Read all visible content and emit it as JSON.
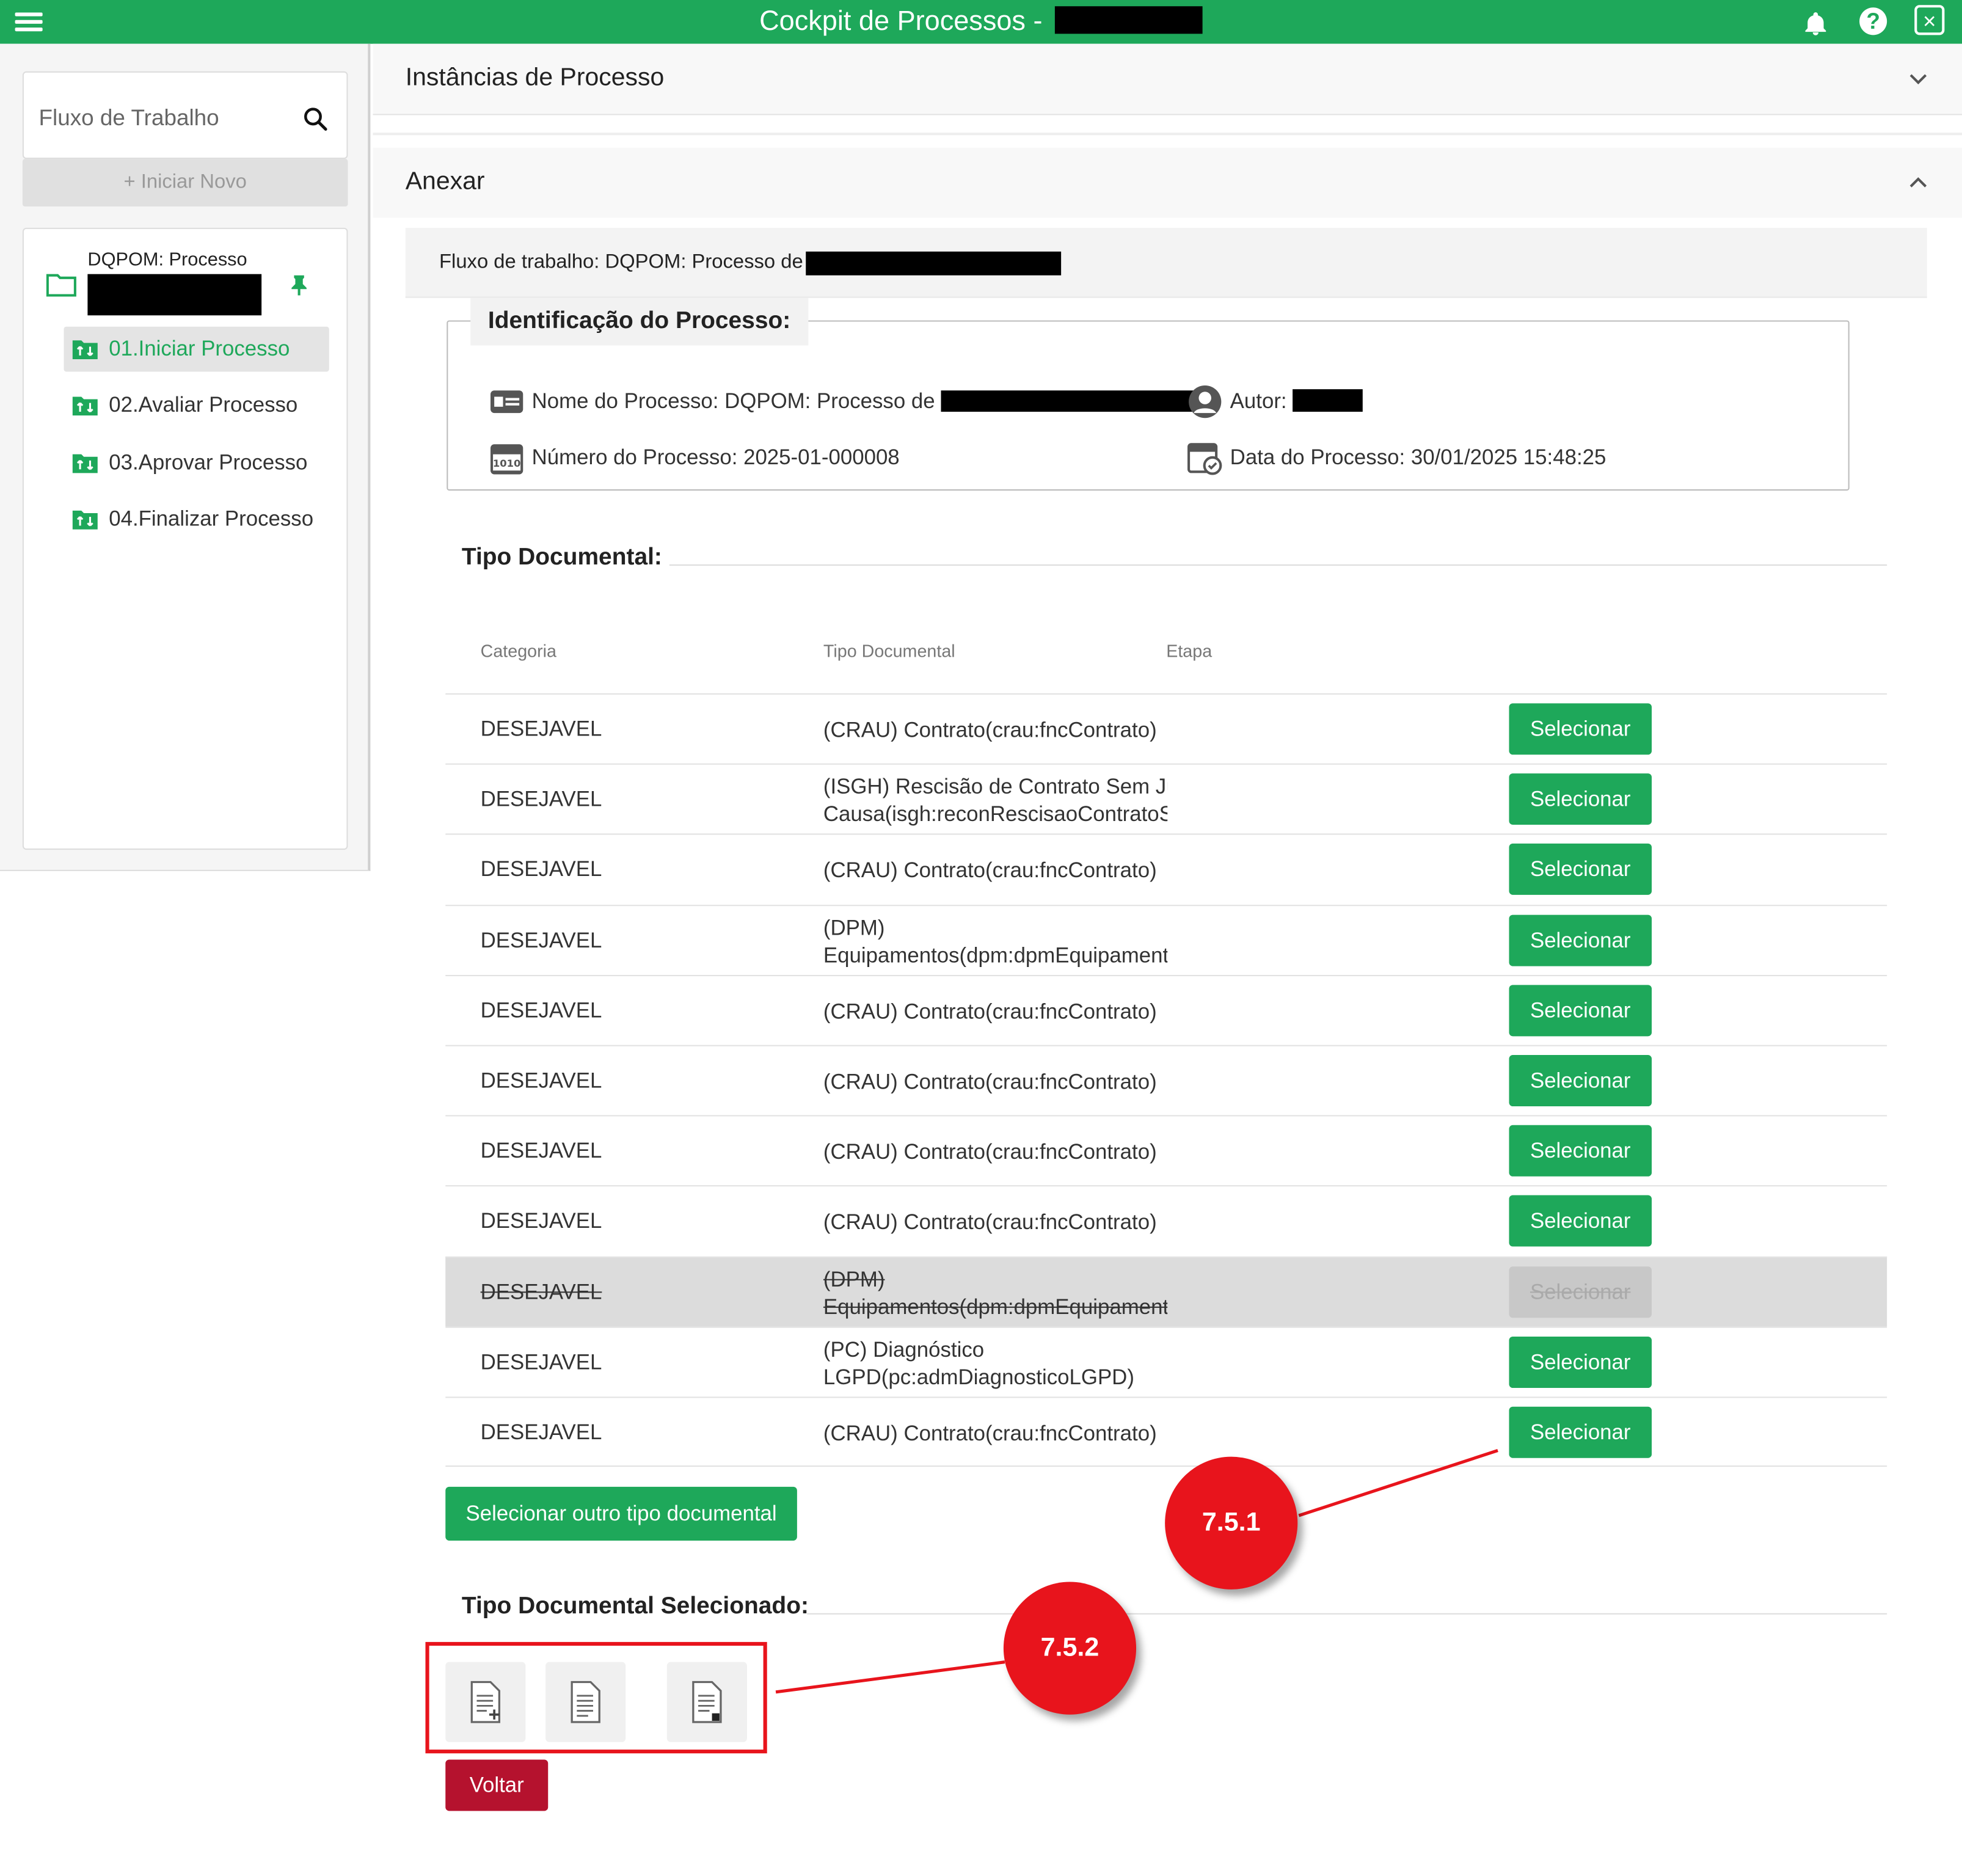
{
  "app": {
    "title": "Cockpit de Processos - ",
    "help_glyph": "?",
    "close_glyph": "×"
  },
  "sidebar": {
    "search_placeholder": "Fluxo de Trabalho",
    "new_button": "+ Iniciar Novo",
    "process_label": "DQPOM: Processo",
    "steps": [
      {
        "label": "01.Iniciar Processo",
        "active": true
      },
      {
        "label": "02.Avaliar Processo",
        "active": false
      },
      {
        "label": "03.Aprovar Processo",
        "active": false
      },
      {
        "label": "04.Finalizar Processo",
        "active": false
      }
    ]
  },
  "main": {
    "section_instances": "Instâncias de Processo",
    "section_anexar": "Anexar",
    "fluxo_label": "Fluxo de trabalho: DQPOM: Processo de ",
    "identification": {
      "legend": "Identificação do Processo:",
      "nome_label": "Nome do Processo: DQPOM: Processo de ",
      "autor_label": "Autor: ",
      "numero_label": "Número do Processo: 2025-01-000008",
      "data_label": "Data do Processo: 30/01/2025 15:48:25"
    },
    "tipo_documental_title": "Tipo Documental:",
    "table": {
      "headers": [
        "Categoria",
        "Tipo Documental",
        "Etapa"
      ],
      "rows": [
        {
          "categoria": "DESEJAVEL",
          "tipo": [
            "(CRAU) Contrato(crau:fncContrato)"
          ],
          "button": "Selecionar",
          "disabled": false
        },
        {
          "categoria": "DESEJAVEL",
          "tipo": [
            "(ISGH) Rescisão de Contrato Sem Jus",
            "Causa(isgh:reconRescisaoContratoSe"
          ],
          "button": "Selecionar",
          "disabled": false
        },
        {
          "categoria": "DESEJAVEL",
          "tipo": [
            "(CRAU) Contrato(crau:fncContrato)"
          ],
          "button": "Selecionar",
          "disabled": false
        },
        {
          "categoria": "DESEJAVEL",
          "tipo": [
            "(DPM)",
            "Equipamentos(dpm:dpmEquipament"
          ],
          "button": "Selecionar",
          "disabled": false
        },
        {
          "categoria": "DESEJAVEL",
          "tipo": [
            "(CRAU) Contrato(crau:fncContrato)"
          ],
          "button": "Selecionar",
          "disabled": false
        },
        {
          "categoria": "DESEJAVEL",
          "tipo": [
            "(CRAU) Contrato(crau:fncContrato)"
          ],
          "button": "Selecionar",
          "disabled": false
        },
        {
          "categoria": "DESEJAVEL",
          "tipo": [
            "(CRAU) Contrato(crau:fncContrato)"
          ],
          "button": "Selecionar",
          "disabled": false
        },
        {
          "categoria": "DESEJAVEL",
          "tipo": [
            "(CRAU) Contrato(crau:fncContrato)"
          ],
          "button": "Selecionar",
          "disabled": false
        },
        {
          "categoria": "DESEJAVEL",
          "tipo": [
            "(DPM)",
            "Equipamentos(dpm:dpmEquipament"
          ],
          "button": "Selecionar",
          "disabled": true
        },
        {
          "categoria": "DESEJAVEL",
          "tipo": [
            "(PC) Diagnóstico",
            "LGPD(pc:admDiagnosticoLGPD)"
          ],
          "button": "Selecionar",
          "disabled": false
        },
        {
          "categoria": "DESEJAVEL",
          "tipo": [
            "(CRAU) Contrato(crau:fncContrato)"
          ],
          "button": "Selecionar",
          "disabled": false
        }
      ]
    },
    "outro_button": "Selecionar outro tipo documental",
    "selecionado_title": "Tipo Documental Selecionado:",
    "doc_actions": [
      "document-add-icon",
      "document-icon",
      "document-list-icon"
    ],
    "voltar_button": "Voltar"
  },
  "annotations": {
    "callout_1": "7.5.1",
    "callout_2": "7.5.2",
    "color": "#e8141c"
  },
  "colors": {
    "primary_green": "#1ea85a",
    "voltar_red": "#b5122e"
  }
}
